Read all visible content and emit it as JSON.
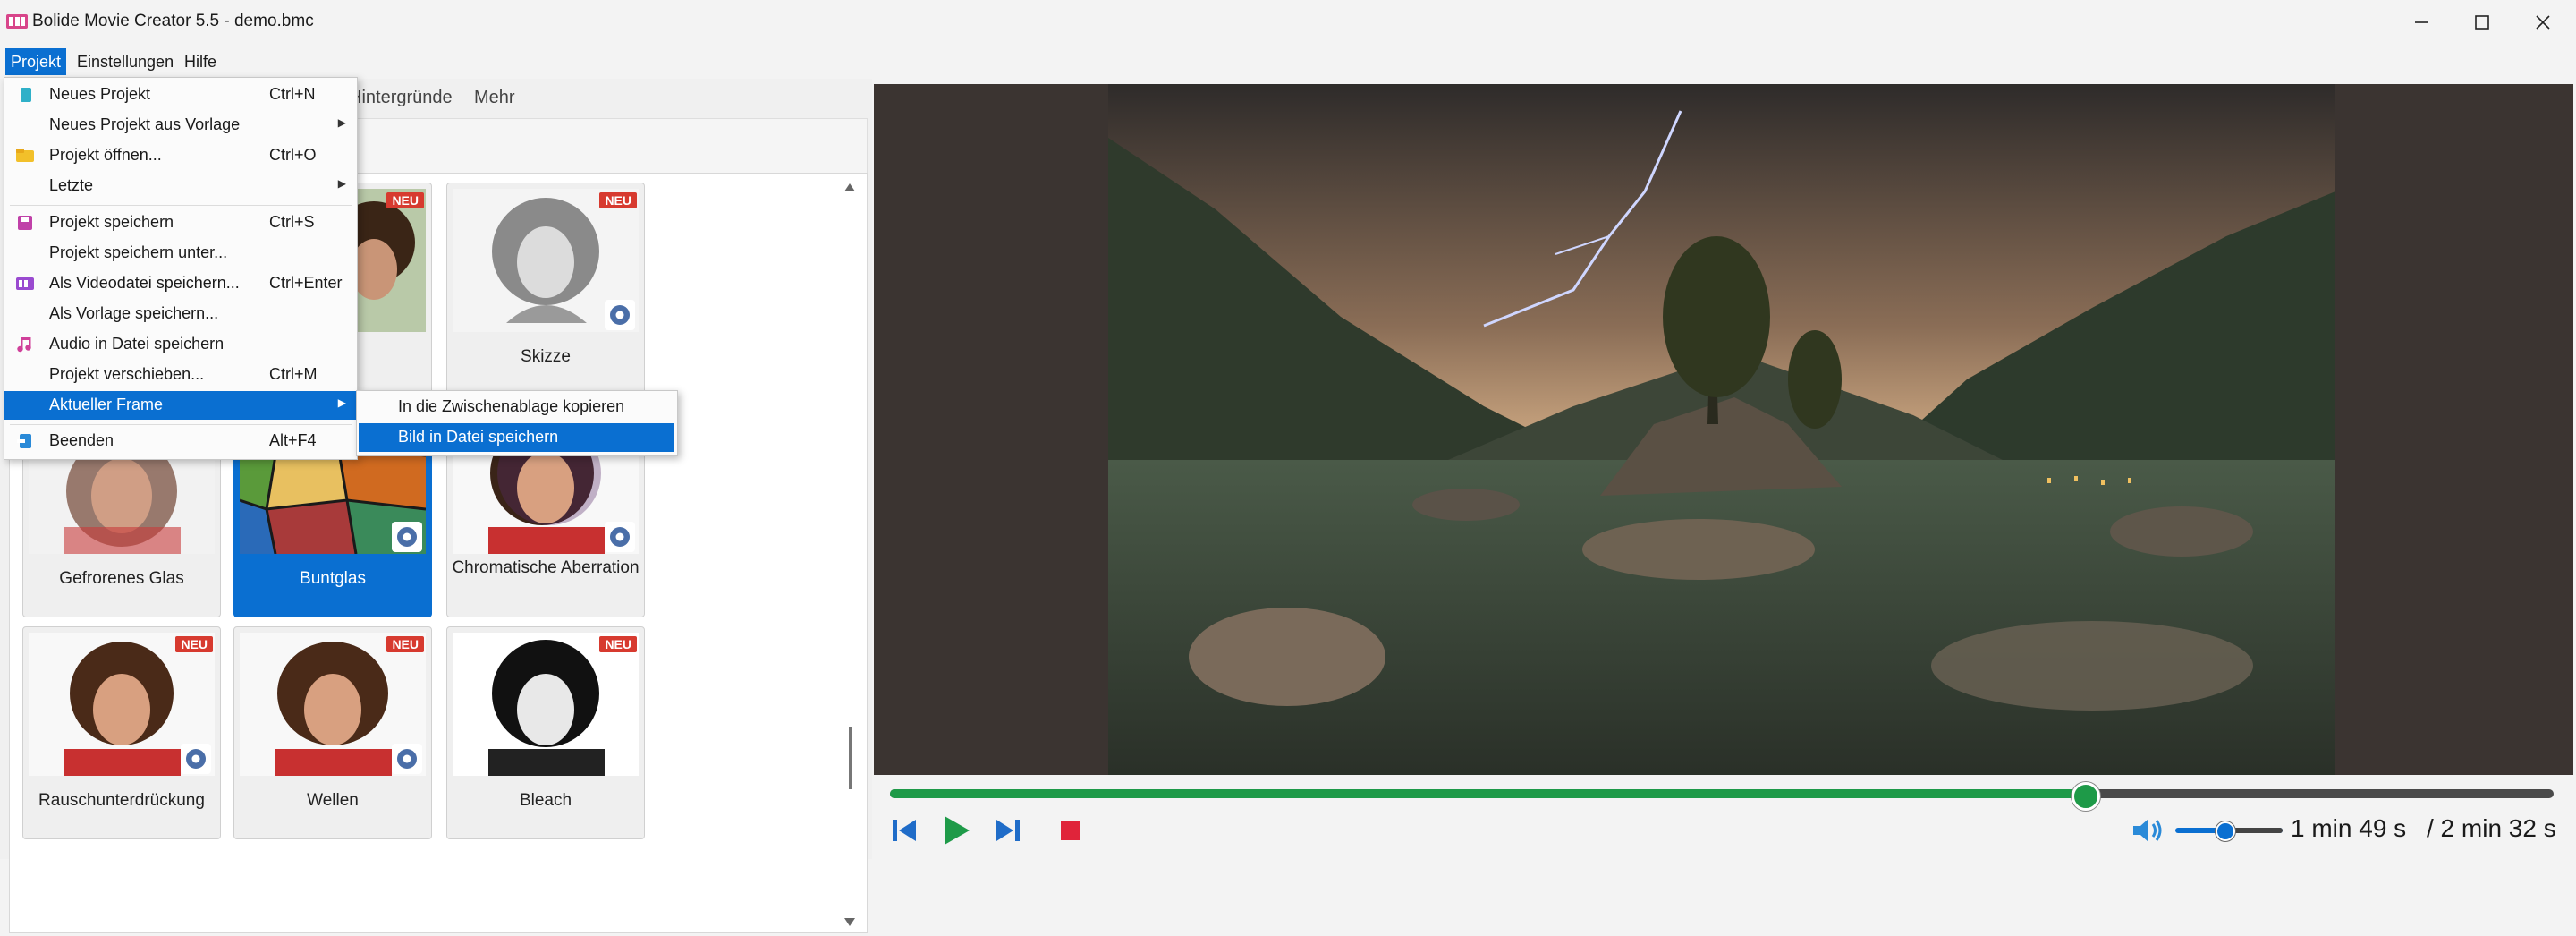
{
  "window": {
    "title": "Bolide Movie Creator 5.5 - demo.bmc",
    "controls": [
      "minimize-icon",
      "maximize-icon",
      "close-icon"
    ]
  },
  "menubar": {
    "items": [
      {
        "label": "Projekt",
        "active": true
      },
      {
        "label": "Einstellungen"
      },
      {
        "label": "Hilfe"
      }
    ]
  },
  "tabs": [
    "Hintergründe",
    "Mehr"
  ],
  "projekt_menu": {
    "items": [
      {
        "label": "Neues Projekt",
        "shortcut": "Ctrl+N",
        "icon": "new-file-icon"
      },
      {
        "label": "Neues Projekt aus Vorlage",
        "submenu": true
      },
      {
        "label": "Projekt öffnen...",
        "shortcut": "Ctrl+O",
        "icon": "folder-icon"
      },
      {
        "label": "Letzte",
        "submenu": true
      },
      {
        "label": "Projekt speichern",
        "shortcut": "Ctrl+S",
        "icon": "save-icon"
      },
      {
        "label": "Projekt speichern unter..."
      },
      {
        "label": "Als Videodatei speichern...",
        "shortcut": "Ctrl+Enter",
        "icon": "film-icon"
      },
      {
        "label": "Als Vorlage speichern..."
      },
      {
        "label": "Audio in Datei speichern",
        "icon": "music-icon"
      },
      {
        "label": "Projekt verschieben...",
        "shortcut": "Ctrl+M"
      },
      {
        "label": "Aktueller Frame",
        "submenu": true,
        "highlighted": true
      },
      {
        "label": "Beenden",
        "shortcut": "Alt+F4",
        "icon": "exit-icon"
      }
    ],
    "submenu_arrow": "▶"
  },
  "frame_submenu": {
    "items": [
      {
        "label": "In die Zwischenablage kopieren"
      },
      {
        "label": "Bild in Datei speichern",
        "highlighted": true
      }
    ]
  },
  "effects": {
    "badge": "NEU",
    "items": [
      {
        "label": "Skizze",
        "badge": true
      },
      {
        "label": "Gefrorenes Glas"
      },
      {
        "label": "Buntglas",
        "selected": true
      },
      {
        "label": "Chromatische Aberration"
      },
      {
        "label": "Rauschunterdrückung",
        "badge": true
      },
      {
        "label": "Wellen",
        "badge": true
      },
      {
        "label": "Bleach",
        "badge": true
      }
    ]
  },
  "player": {
    "current_time": "1 min 49 s",
    "total_time": "/ 2 min 32 s",
    "progress": 0.717,
    "volume": 0.45
  },
  "colors": {
    "accent": "#0a6fd1",
    "progress": "#1e9a48",
    "badge": "#d73a2f"
  }
}
